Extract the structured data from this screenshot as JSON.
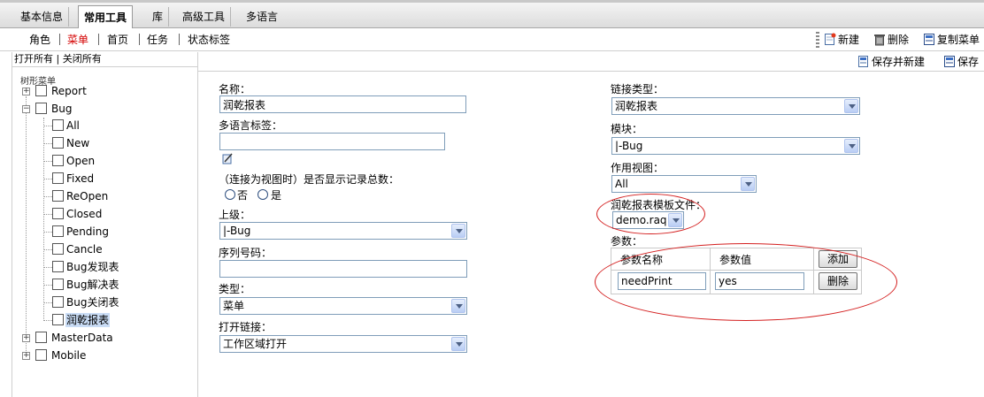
{
  "tabs": [
    {
      "label": "基本信息"
    },
    {
      "label": "常用工具",
      "active": true
    },
    {
      "label": "库"
    },
    {
      "label": "高级工具"
    },
    {
      "label": "多语言"
    }
  ],
  "subnav": [
    {
      "label": "角色"
    },
    {
      "label": "菜单",
      "active": true
    },
    {
      "label": "首页"
    },
    {
      "label": "任务"
    },
    {
      "label": "状态标签"
    }
  ],
  "toolbar": {
    "new_label": "新建",
    "delete_label": "删除",
    "copy_label": "复制菜单"
  },
  "left": {
    "open_all": "打开所有",
    "separator": "|",
    "close_all": "关闭所有",
    "tree_title": "树形菜单",
    "root_nodes": [
      {
        "label": "Report",
        "expander": "+"
      },
      {
        "label": "Bug",
        "expander": "−"
      },
      {
        "label": "MasterData",
        "expander": "+"
      },
      {
        "label": "Mobile",
        "expander": "+"
      }
    ],
    "bug_children": [
      {
        "label": "All"
      },
      {
        "label": "New"
      },
      {
        "label": "Open"
      },
      {
        "label": "Fixed"
      },
      {
        "label": "ReOpen"
      },
      {
        "label": "Closed"
      },
      {
        "label": "Pending"
      },
      {
        "label": "Cancle"
      },
      {
        "label": "Bug发现表"
      },
      {
        "label": "Bug解决表"
      },
      {
        "label": "Bug关闭表"
      },
      {
        "label": "润乾报表",
        "selected": true
      }
    ]
  },
  "savebar": {
    "save_new_label": "保存并新建",
    "save_label": "保存"
  },
  "form": {
    "name_label": "名称：",
    "name_value": "润乾报表",
    "i18n_label": "多语言标签：",
    "i18n_value": "",
    "show_count_label": "（连接为视图时）是否显示记录总数：",
    "radio_no": "否",
    "radio_yes": "是",
    "parent_label": "上级：",
    "parent_value": "|-Bug",
    "seq_label": "序列号码：",
    "seq_value": "",
    "type_label": "类型：",
    "type_value": "菜单",
    "open_link_label": "打开链接：",
    "open_link_value": "工作区域打开",
    "link_type_label": "链接类型：",
    "link_type_value": "润乾报表",
    "module_label": "模块：",
    "module_value": "|-Bug",
    "view_label": "作用视图：",
    "view_value": "All",
    "template_label": "润乾报表模板文件：",
    "template_value": "demo.raq",
    "params_label": "参数：",
    "param_name_header": "参数名称",
    "param_value_header": "参数值",
    "add_button": "添加",
    "param_name": "needPrint",
    "param_value": "yes",
    "remove_button": "删除"
  },
  "colors": {
    "accent_red": "#d40000",
    "annotation_red": "#d42020",
    "input_border": "#7f9db9"
  }
}
